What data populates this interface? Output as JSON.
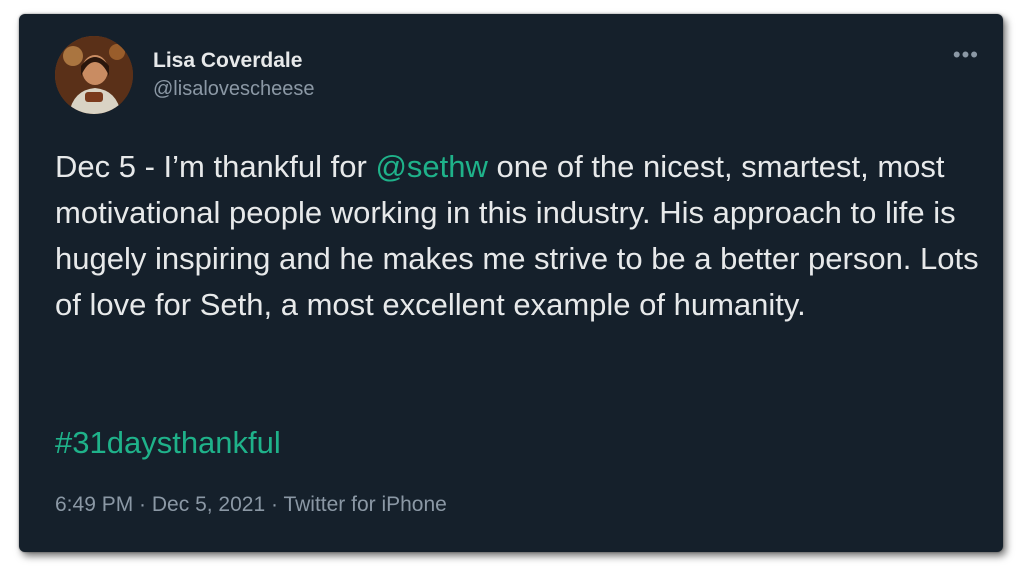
{
  "author": {
    "display_name": "Lisa Coverdale",
    "handle": "@lisalovescheese"
  },
  "more_label": "•••",
  "tweet": {
    "text_part1": "Dec 5 - I’m thankful for ",
    "mention": "@sethw",
    "text_part2": " one of the nicest, smartest, most motivational people working in this industry. His approach to life is hugely inspiring and he makes me strive to be a better person. Lots of love for Seth, a most excellent example of humanity.",
    "hashtag": "#31daysthankful"
  },
  "meta": {
    "time": "6:49 PM",
    "sep1": " · ",
    "date": "Dec 5, 2021",
    "sep2": " · ",
    "source": "Twitter for iPhone"
  },
  "colors": {
    "background": "#15202b",
    "text": "#e7e9ea",
    "secondary": "#8b98a5",
    "link": "#1fb28a"
  }
}
